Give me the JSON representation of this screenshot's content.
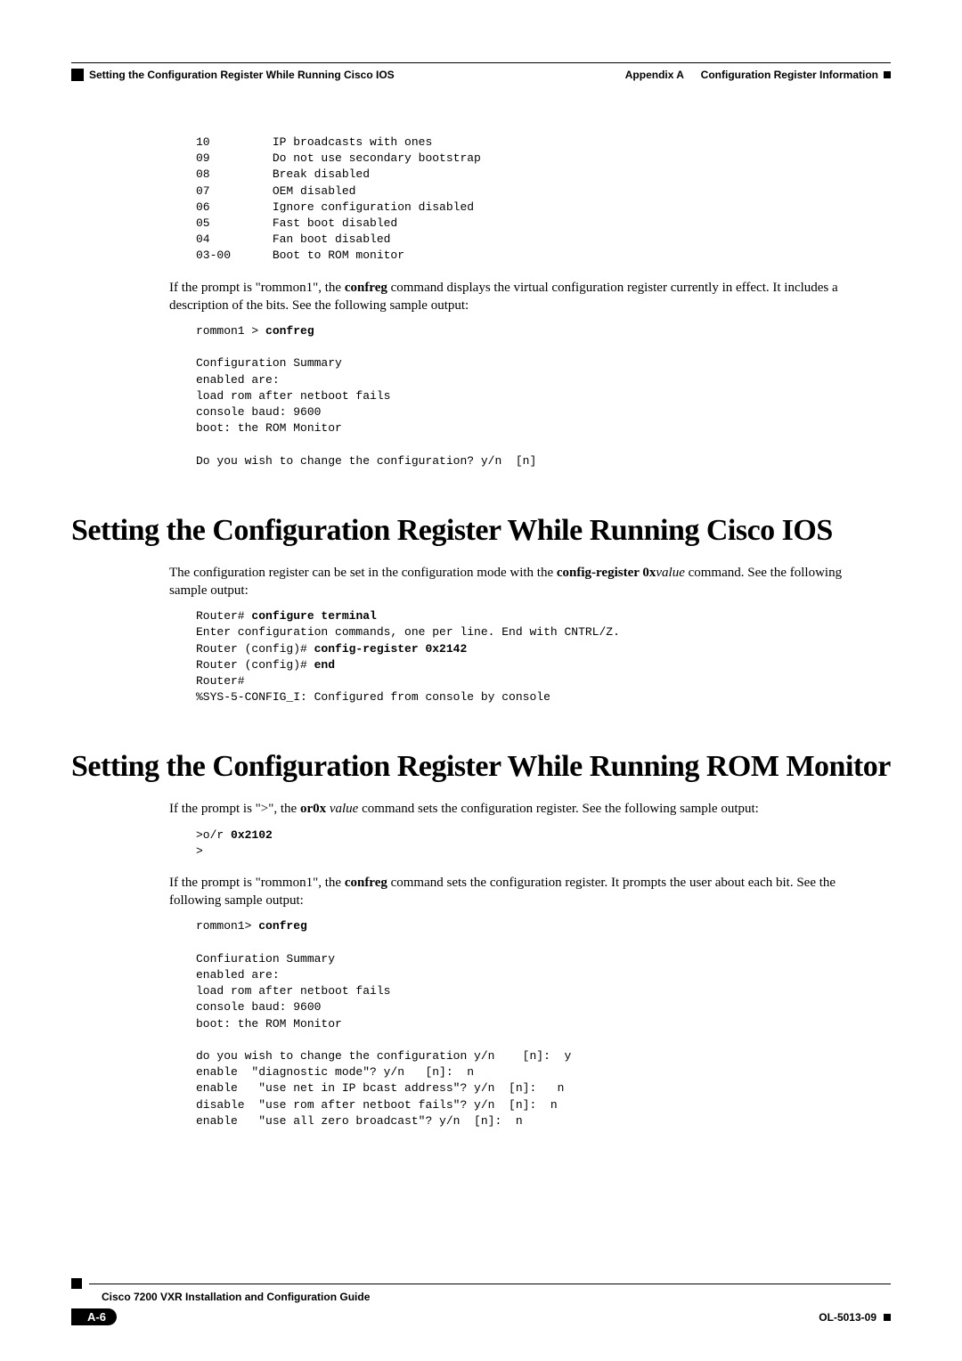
{
  "header": {
    "appendix_label": "Appendix A",
    "appendix_title": "Configuration Register Information",
    "section_title": "Setting the Configuration Register While Running Cisco IOS"
  },
  "code1": "10         IP broadcasts with ones\n09         Do not use secondary bootstrap\n08         Break disabled\n07         OEM disabled\n06         Ignore configuration disabled\n05         Fast boot disabled\n04         Fan boot disabled\n03-00      Boot to ROM monitor",
  "para1": {
    "p1": "If the prompt is \"rommon1\", the ",
    "b1": "confreg",
    "p2": " command displays the virtual configuration register currently in effect. It includes a description of the bits. See the following sample output:"
  },
  "code2": {
    "line1": "rommon1 > ",
    "bold1": "confreg",
    "rest": "\n\nConfiguration Summary\nenabled are:\nload rom after netboot fails\nconsole baud: 9600\nboot: the ROM Monitor\n\nDo you wish to change the configuration? y/n  [n]"
  },
  "heading1": "Setting the Configuration Register While Running Cisco IOS",
  "para2": {
    "p1": "The configuration register can be set in the configuration mode with the ",
    "b1": "config-register 0x",
    "i1": "value",
    "p2": " command. See the following sample output:"
  },
  "code3": {
    "l1a": "Router# ",
    "l1b": "configure terminal",
    "l2": "\nEnter configuration commands, one per line. End with CNTRL/Z.\nRouter (config)# ",
    "l2b": "config-register 0x2142",
    "l3": "\nRouter (config)# ",
    "l3b": "end",
    "l4": "\nRouter#\n%SYS-5-CONFIG_I: Configured from console by console"
  },
  "heading2": "Setting the Configuration Register While Running ROM Monitor",
  "para3": {
    "p1": "If the prompt is \">\", the ",
    "b1": "or0x ",
    "i1": "value",
    "p2": " command sets the configuration register. See the following sample output:"
  },
  "code4": {
    "l1a": ">o/r ",
    "l1b": "0x2102",
    "l2": "\n>"
  },
  "para4": {
    "p1": "If the prompt is \"rommon1\", the ",
    "b1": "confreg",
    "p2": " command sets the configuration register. It prompts the user about each bit. See the following sample output:"
  },
  "code5": {
    "l1a": "rommon1> ",
    "l1b": "confreg",
    "rest": "\n\nConfiuration Summary\nenabled are:\nload rom after netboot fails\nconsole baud: 9600\nboot: the ROM Monitor\n\ndo you wish to change the configuration y/n    [n]:  y\nenable  \"diagnostic mode\"? y/n   [n]:  n\nenable   \"use net in IP bcast address\"? y/n  [n]:   n\ndisable  \"use rom after netboot fails\"? y/n  [n]:  n\nenable   \"use all zero broadcast\"? y/n  [n]:  n"
  },
  "footer": {
    "title": "Cisco 7200 VXR Installation and Configuration Guide",
    "page": "A-6",
    "doc": "OL-5013-09"
  }
}
